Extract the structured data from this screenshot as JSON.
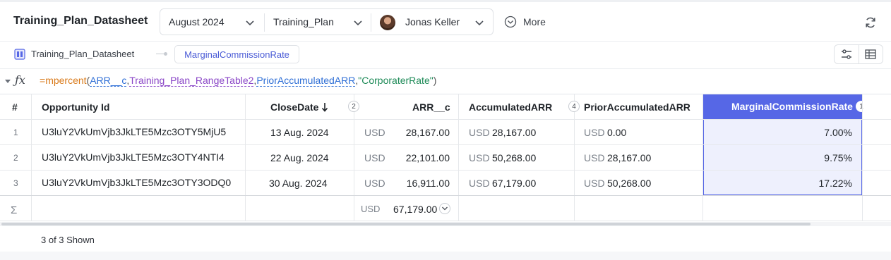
{
  "header": {
    "title": "Training_Plan_Datasheet",
    "period": "August 2024",
    "plan": "Training_Plan",
    "user": "Jonas Keller",
    "more": "More"
  },
  "breadcrumb": {
    "sheet": "Training_Plan_Datasheet",
    "column": "MarginalCommissionRate"
  },
  "formula": {
    "eq": "=",
    "fn": "mpercent",
    "open": "(",
    "arg1": "ARR__c",
    "c1": ",",
    "arg2": "Training_Plan_RangeTable2",
    "c2": ",",
    "arg3": "PriorAccumulatedARR",
    "c3": ",",
    "arg4": "\"CorporaterRate\"",
    "close": ")"
  },
  "table": {
    "headers": {
      "index": "#",
      "opp": "Opportunity Id",
      "close": "CloseDate",
      "close_badge": "2",
      "arr": "ARR__c",
      "acc": "AccumulatedARR",
      "acc_badge": "4",
      "prior": "PriorAccumulatedARR",
      "rate": "MarginalCommissionRate",
      "rate_badge": "1"
    },
    "rows": [
      {
        "n": "1",
        "opp": "U3luY2VkUmVjb3JkLTE5Mzc3OTY5MjU5",
        "close": "13 Aug. 2024",
        "arr_cur": "USD",
        "arr": "28,167.00",
        "acc_cur": "USD",
        "acc": "28,167.00",
        "prior_cur": "USD",
        "prior": "0.00",
        "rate": "7.00%"
      },
      {
        "n": "2",
        "opp": "U3luY2VkUmVjb3JkLTE5Mzc3OTY4NTI4",
        "close": "22 Aug. 2024",
        "arr_cur": "USD",
        "arr": "22,101.00",
        "acc_cur": "USD",
        "acc": "50,268.00",
        "prior_cur": "USD",
        "prior": "28,167.00",
        "rate": "9.75%"
      },
      {
        "n": "3",
        "opp": "U3luY2VkUmVjb3JkLTE5Mzc3OTY3ODQ0",
        "close": "30 Aug. 2024",
        "arr_cur": "USD",
        "arr": "16,911.00",
        "acc_cur": "USD",
        "acc": "67,179.00",
        "prior_cur": "USD",
        "prior": "50,268.00",
        "rate": "17.22%"
      }
    ],
    "summary": {
      "sigma": "Σ",
      "cur": "USD",
      "value": "67,179.00"
    }
  },
  "footer": {
    "shown": "3 of 3 Shown"
  },
  "colors": {
    "accent": "#5667e6",
    "selected_bg": "#eef0fd",
    "function": "#d97a1a",
    "string": "#1d8a57"
  }
}
